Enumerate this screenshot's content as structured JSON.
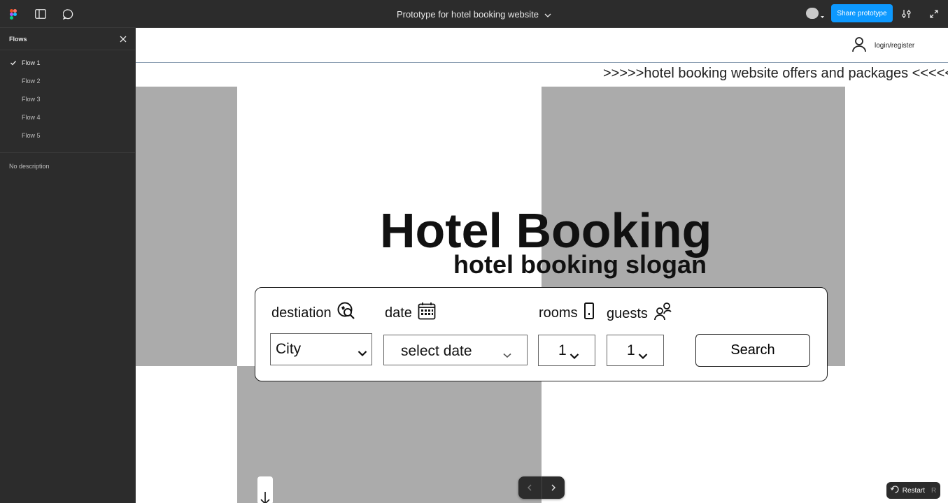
{
  "topbar": {
    "title": "Prototype for hotel booking website",
    "share_label": "Share prototype"
  },
  "sidebar": {
    "heading": "Flows",
    "flows": [
      {
        "label": "Flow 1",
        "active": true
      },
      {
        "label": "Flow 2"
      },
      {
        "label": "Flow 3"
      },
      {
        "label": "Flow 4"
      },
      {
        "label": "Flow 5"
      }
    ],
    "description": "No description"
  },
  "site": {
    "login_label": "login/register",
    "marquee": ">>>>>hotel booking website offers and packages <<<<<",
    "title": "Hotel Booking",
    "slogan": "hotel booking slogan",
    "form": {
      "destination_label": "destiation",
      "date_label": "date",
      "rooms_label": "rooms",
      "guests_label": "guests",
      "city_value": "City",
      "date_value": "select date",
      "rooms_value": "1",
      "guests_value": "1",
      "search_label": "Search"
    }
  },
  "controls": {
    "restart_label": "Restart",
    "restart_key": "R"
  },
  "colors": {
    "accent": "#0d99ff",
    "chrome": "#2c2c2c",
    "hero_gray": "#ababab"
  }
}
